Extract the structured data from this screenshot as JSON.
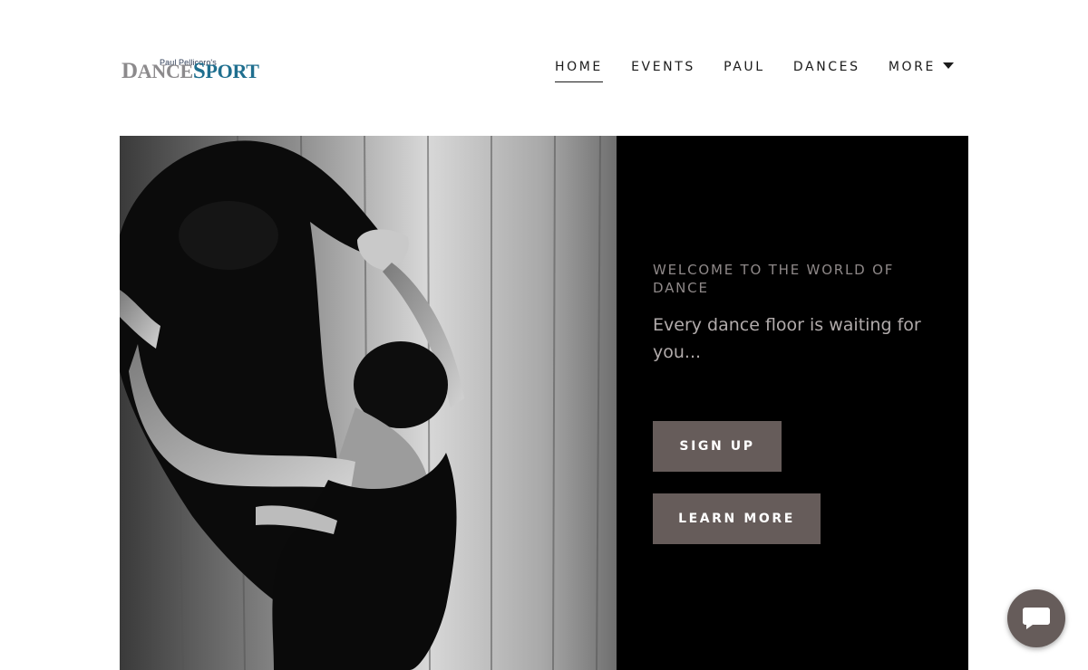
{
  "logo": {
    "owner": "Paul Pellicoro's",
    "dance_d": "D",
    "dance_rest": "ANCE",
    "sport_s": "S",
    "sport_rest": "PORT"
  },
  "nav": {
    "items": [
      {
        "label": "HOME",
        "active": true
      },
      {
        "label": "EVENTS",
        "active": false
      },
      {
        "label": "PAUL",
        "active": false
      },
      {
        "label": "DANCES",
        "active": false
      },
      {
        "label": "MORE",
        "active": false,
        "has_dropdown": true
      }
    ]
  },
  "hero": {
    "eyebrow": "WELCOME TO THE WORLD OF DANCE",
    "tagline": "Every dance floor is waiting for you...",
    "primary_button": "SIGN UP",
    "secondary_button": "LEARN MORE",
    "image_description_icon": "dancing-couple-photo"
  },
  "chat": {
    "icon": "chat-bubble-icon"
  },
  "colors": {
    "nav_text": "#1b1b1b",
    "panel_bg": "#000000",
    "button_bg": "#665c5a",
    "eyebrow_text": "#8e8888",
    "tagline_text": "#b1abab",
    "logo_grey": "#8c8a8c",
    "logo_blue": "#1f6f8f"
  }
}
